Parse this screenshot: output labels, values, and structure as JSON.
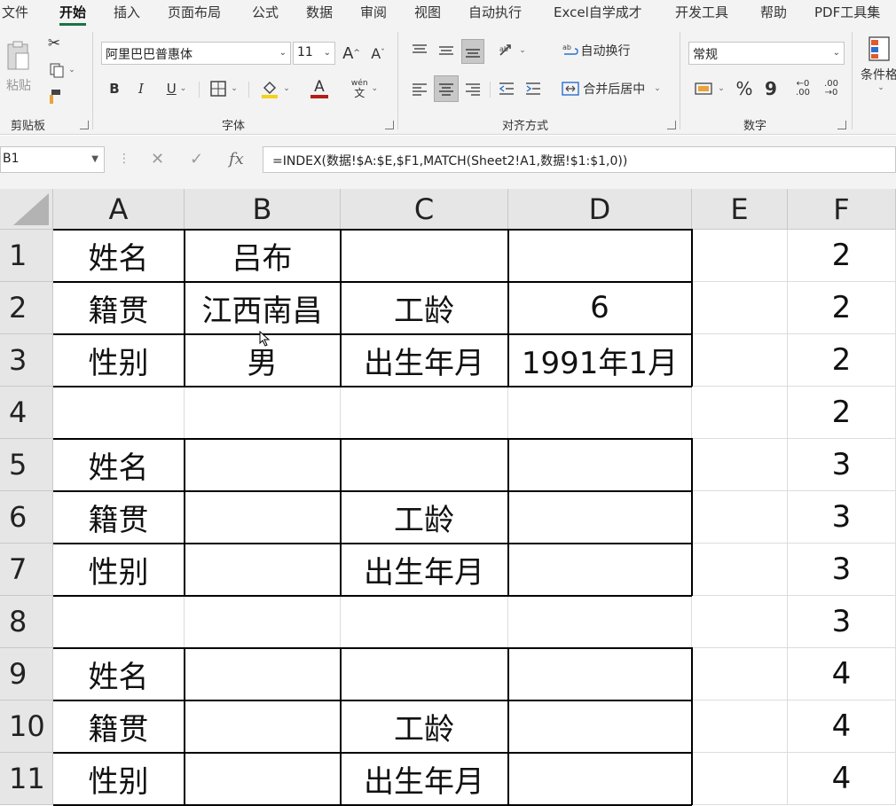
{
  "menu": {
    "tabs": [
      {
        "label": "文件",
        "active": false
      },
      {
        "label": "开始",
        "active": true
      },
      {
        "label": "插入",
        "active": false
      },
      {
        "label": "页面布局",
        "active": false
      },
      {
        "label": "公式",
        "active": false
      },
      {
        "label": "数据",
        "active": false
      },
      {
        "label": "审阅",
        "active": false
      },
      {
        "label": "视图",
        "active": false
      },
      {
        "label": "自动执行",
        "active": false
      },
      {
        "label": "Excel自学成才",
        "active": false
      },
      {
        "label": "开发工具",
        "active": false
      },
      {
        "label": "帮助",
        "active": false
      },
      {
        "label": "PDF工具集",
        "active": false
      }
    ]
  },
  "ribbon": {
    "clipboard": {
      "paste_label": "粘贴",
      "group_label": "剪贴板"
    },
    "font": {
      "font_name": "阿里巴巴普惠体",
      "font_size": "11",
      "grow_label": "A",
      "shrink_label": "A",
      "bold_label": "B",
      "italic_label": "I",
      "underline_label": "U",
      "font_color_label": "A",
      "phonetic_label": "wén",
      "phonetic_char": "文",
      "group_label": "字体"
    },
    "alignment": {
      "wrap_text_label": "自动换行",
      "merge_center_label": "合并后居中",
      "group_label": "对齐方式"
    },
    "number": {
      "format": "常规",
      "percent_label": "%",
      "comma_label": "9",
      "inc_decimal_label": "←0 .00",
      "dec_decimal_label": ".00 →0",
      "group_label": "数字"
    },
    "styles": {
      "conditional_label": "条件格"
    }
  },
  "formula_bar": {
    "name_box": "B1",
    "fx_label": "fx",
    "formula": "=INDEX(数据!$A:$E,$F1,MATCH(Sheet2!A1,数据!$1:$1,0))"
  },
  "sheet": {
    "columns": [
      "A",
      "B",
      "C",
      "D",
      "E",
      "F"
    ],
    "rows": [
      {
        "num": "1",
        "cells": [
          "姓名",
          "吕布",
          "",
          "",
          "",
          "2"
        ]
      },
      {
        "num": "2",
        "cells": [
          "籍贯",
          "江西南昌",
          "工龄",
          "6",
          "",
          "2"
        ]
      },
      {
        "num": "3",
        "cells": [
          "性别",
          "男",
          "出生年月",
          "1991年1月",
          "",
          "2"
        ]
      },
      {
        "num": "4",
        "cells": [
          "",
          "",
          "",
          "",
          "",
          "2"
        ]
      },
      {
        "num": "5",
        "cells": [
          "姓名",
          "",
          "",
          "",
          "",
          "3"
        ]
      },
      {
        "num": "6",
        "cells": [
          "籍贯",
          "",
          "工龄",
          "",
          "",
          "3"
        ]
      },
      {
        "num": "7",
        "cells": [
          "性别",
          "",
          "出生年月",
          "",
          "",
          "3"
        ]
      },
      {
        "num": "8",
        "cells": [
          "",
          "",
          "",
          "",
          "",
          "3"
        ]
      },
      {
        "num": "9",
        "cells": [
          "姓名",
          "",
          "",
          "",
          "",
          "4"
        ]
      },
      {
        "num": "10",
        "cells": [
          "籍贯",
          "",
          "工龄",
          "",
          "",
          "4"
        ]
      },
      {
        "num": "11",
        "cells": [
          "性别",
          "",
          "出生年月",
          "",
          "",
          "4"
        ]
      }
    ]
  }
}
